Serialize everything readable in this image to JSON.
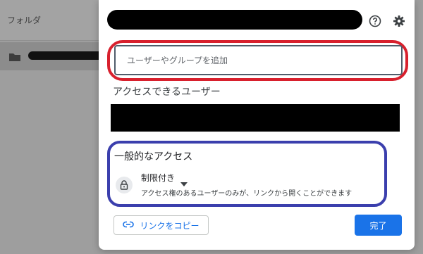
{
  "background": {
    "header_label": "フォルダ",
    "folder_icon": "folder-icon"
  },
  "dialog": {
    "add_people": {
      "placeholder": "ユーザーやグループを追加"
    },
    "people_with_access_heading": "アクセスできるユーザー",
    "general_access": {
      "heading": "一般的なアクセス",
      "icon": "lock-icon",
      "selected_option": "制限付き",
      "description": "アクセス権のあるユーザーのみが、リンクから開くことができます"
    },
    "copy_link_label": "リンクをコピー",
    "done_label": "完了",
    "icons": {
      "help": "help-icon",
      "settings": "gear-icon",
      "link": "link-icon",
      "caret": "caret-down-icon"
    }
  },
  "colors": {
    "accent_blue": "#1a73e8",
    "highlight_red": "#d8202d",
    "highlight_blue": "#3b3fad",
    "overlay_gray": "#9e9e9e"
  }
}
